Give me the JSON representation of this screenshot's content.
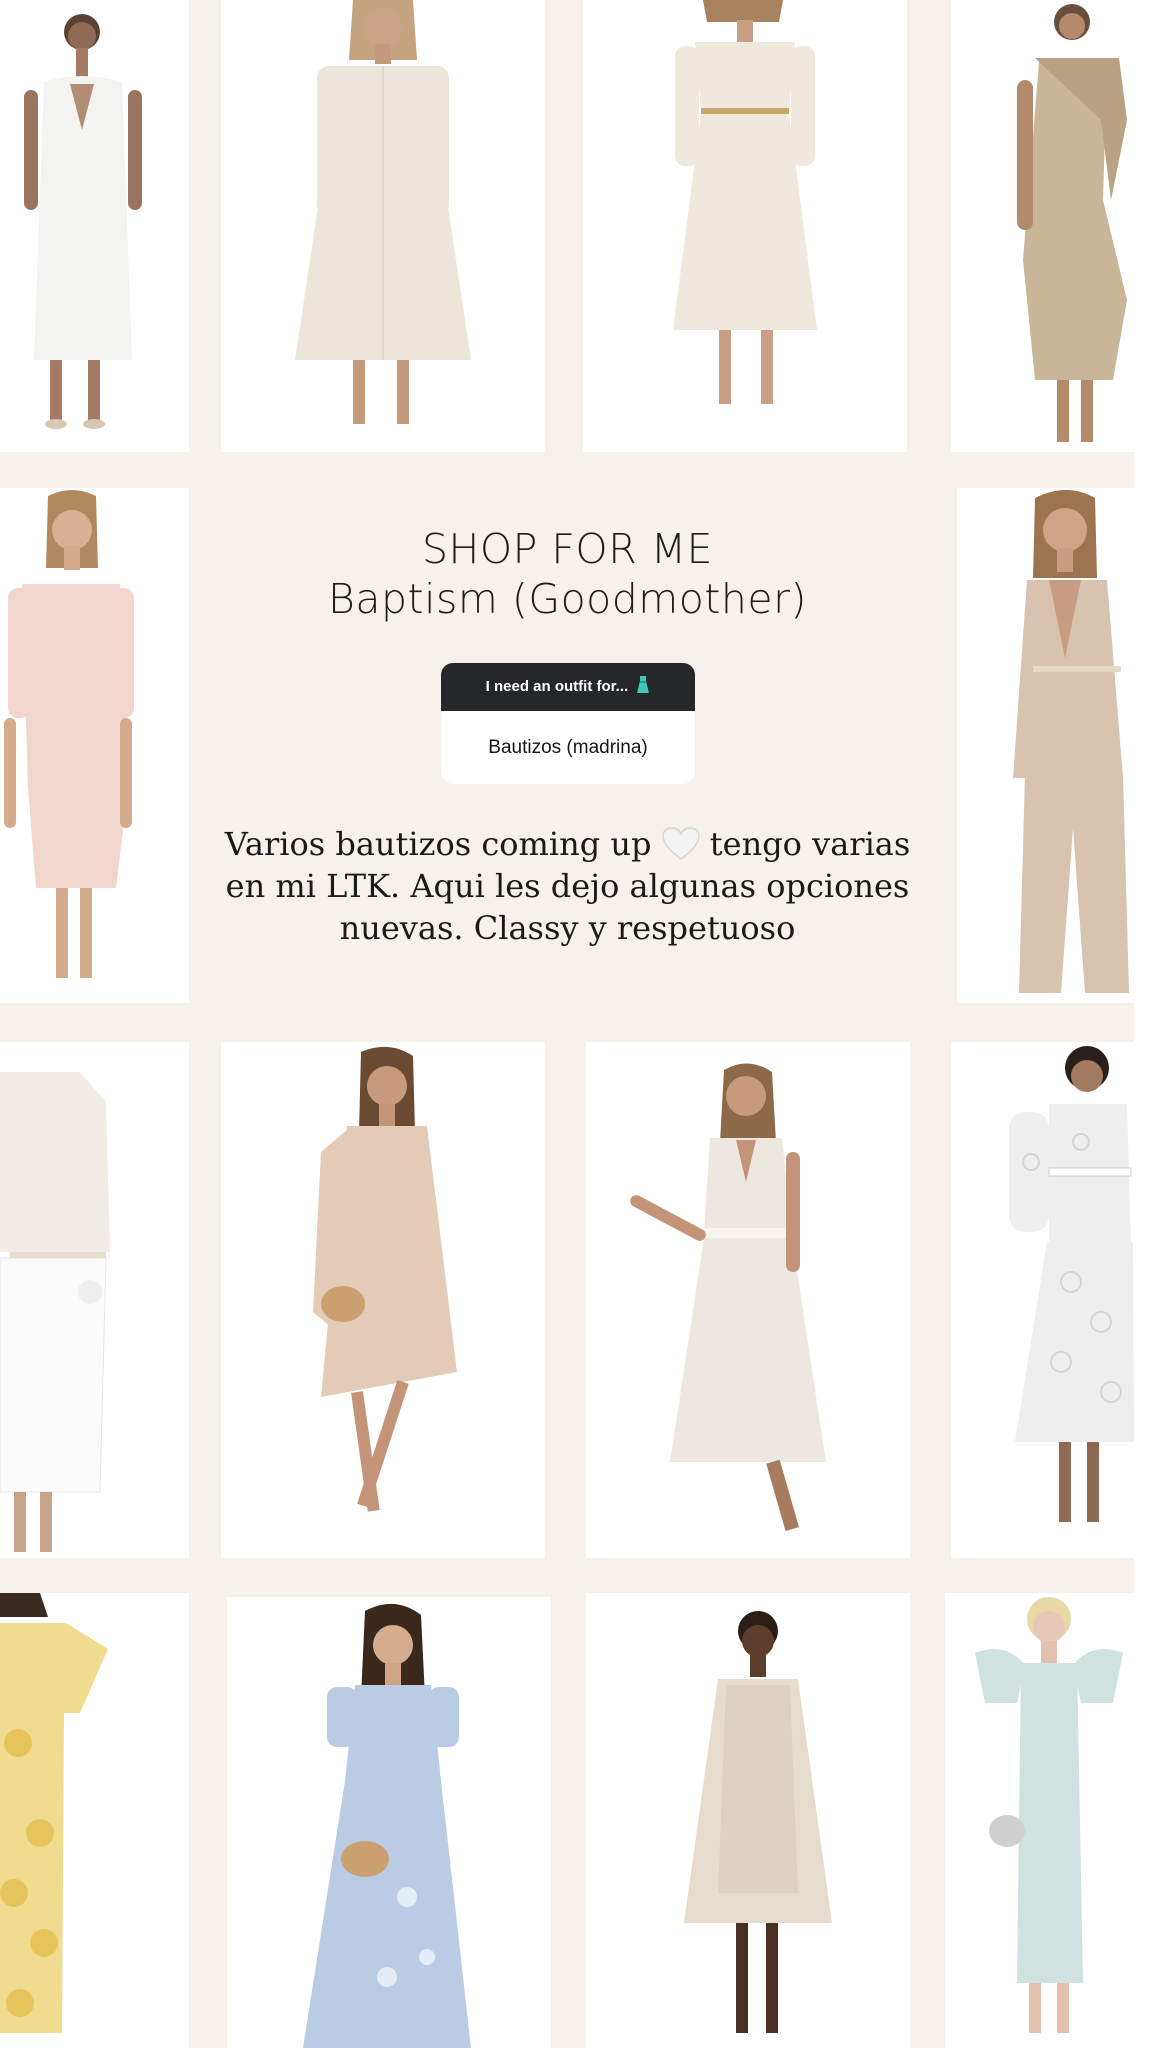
{
  "story": {
    "title": "SHOP FOR ME",
    "subtitle": "Baptism (Goodmother)",
    "question_sticker": {
      "prompt": "I need an outfit for...",
      "prompt_icon": "dress-emoji",
      "answer": "Bautizos (madrina)"
    },
    "caption": {
      "line1_before": "Varios bautizos coming up",
      "line1_icon": "white-heart-emoji",
      "line1_after": "tengo varias",
      "line2": "en mi LTK. Aqui les dejo algunas opciones",
      "line3": "nuevas. Classy y respetuoso"
    }
  },
  "products": [
    {
      "name": "white-sleeveless-midi-dress",
      "color": "#f3f3f1"
    },
    {
      "name": "ivory-shirt-dress",
      "color": "#ece6d8"
    },
    {
      "name": "cream-off-shoulder-knit-dress",
      "color": "#efe8dc"
    },
    {
      "name": "taupe-satin-scarf-dress",
      "color": "#c9b597"
    },
    {
      "name": "blush-cold-shoulder-dress",
      "color": "#f1d6cd"
    },
    {
      "name": "beige-blazer-trouser-suit",
      "color": "#d8c3b0"
    },
    {
      "name": "cream-blazer-white-skirt",
      "color": "#f1ece4"
    },
    {
      "name": "blush-cape-sleeve-dress",
      "color": "#e4cbb7"
    },
    {
      "name": "ivory-wrap-bow-gown",
      "color": "#ece8df"
    },
    {
      "name": "white-lace-shirt-dress",
      "color": "#eeeeee"
    },
    {
      "name": "yellow-floral-appliqué-dress",
      "color": "#f0dc8e"
    },
    {
      "name": "light-blue-embroidered-dress",
      "color": "#b9cce3"
    },
    {
      "name": "cream-cape-mini-dress",
      "color": "#e6dccd"
    },
    {
      "name": "mint-puff-sleeve-dress",
      "color": "#cfe2df"
    }
  ]
}
